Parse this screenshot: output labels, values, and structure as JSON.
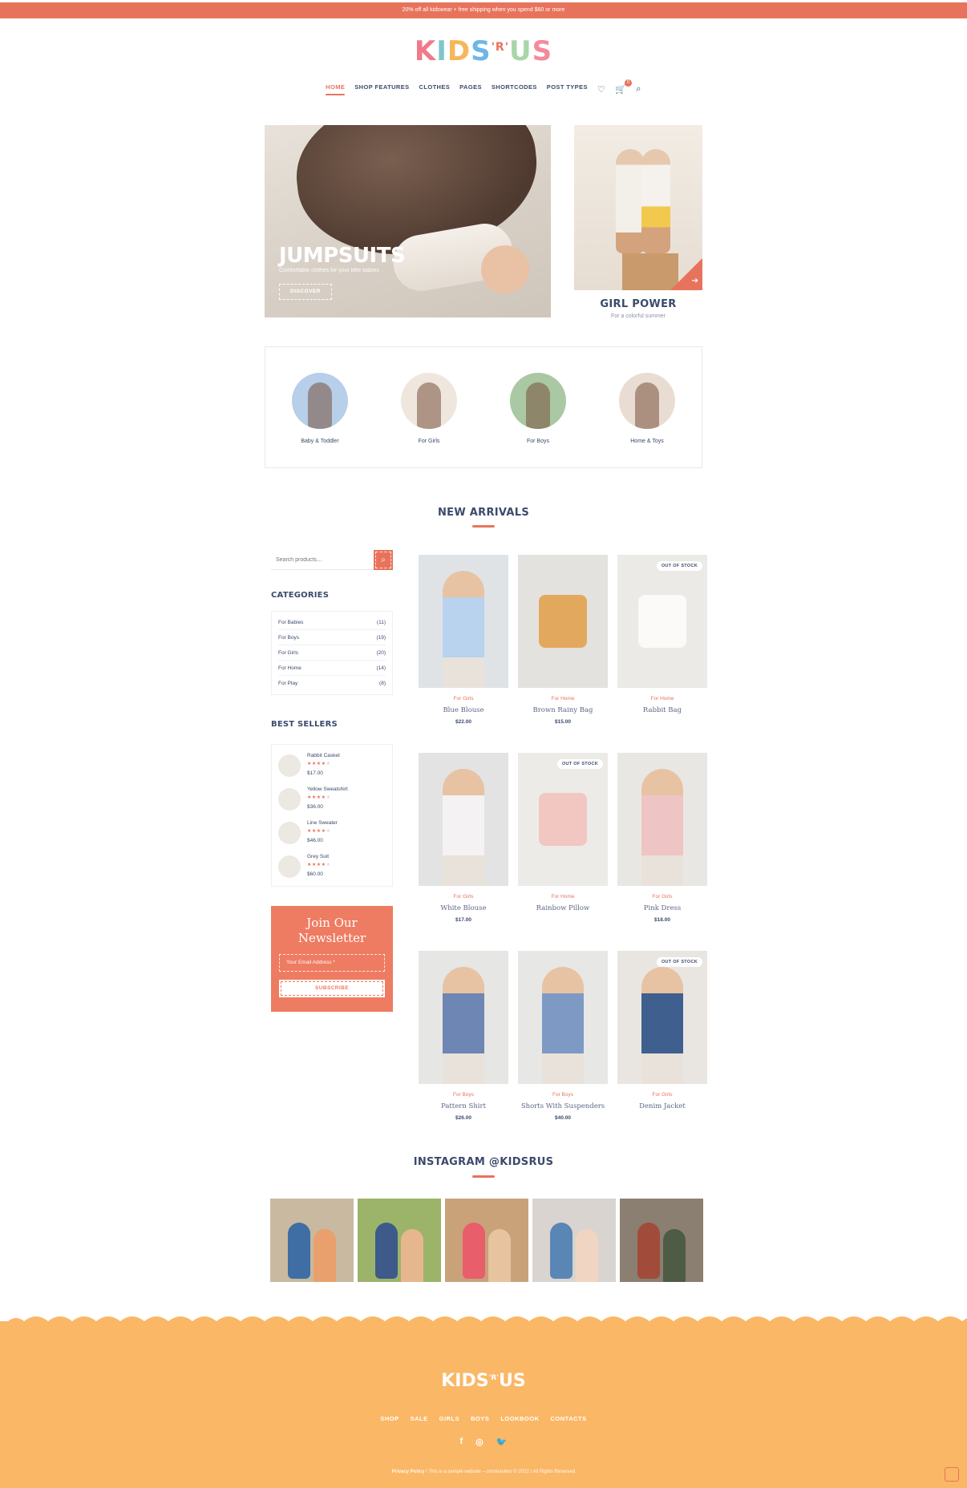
{
  "topbar": {
    "text": "20% off all kidswear + free shipping when you spend $60 or more"
  },
  "logo": {
    "letters": [
      "K",
      "I",
      "D",
      "S",
      "'R'",
      "U",
      "S"
    ],
    "colors": [
      "#f07a8a",
      "#7ec6c9",
      "#f6b65a",
      "#6fb6e8",
      "#e8735c",
      "#a8d6a8",
      "#f48a9a"
    ]
  },
  "nav": {
    "items": [
      "HOME",
      "SHOP FEATURES",
      "CLOTHES",
      "PAGES",
      "SHORTCODES",
      "POST TYPES"
    ],
    "active": "HOME",
    "cart_count": "0",
    "icons": [
      "heart-icon",
      "cart-icon",
      "search-icon"
    ]
  },
  "hero": {
    "title": "JUMPSUITS",
    "subtitle": "Comfortable clothes for your little babies",
    "button": "DISCOVER"
  },
  "promo": {
    "title": "GIRL POWER",
    "subtitle": "For a colorful summer"
  },
  "categories": [
    {
      "label": "Baby & Toddler",
      "bg": "#b7cfe8"
    },
    {
      "label": "For Girls",
      "bg": "#efe7de"
    },
    {
      "label": "For Boys",
      "bg": "#a9c8a3"
    },
    {
      "label": "Home & Toys",
      "bg": "#e9ddd3"
    }
  ],
  "new_arrivals": {
    "title": "NEW ARRIVALS"
  },
  "sidebar": {
    "search_placeholder": "Search products…",
    "categories_title": "CATEGORIES",
    "categories": [
      {
        "name": "For Babies",
        "count": "(11)"
      },
      {
        "name": "For Boys",
        "count": "(19)"
      },
      {
        "name": "For Girls",
        "count": "(20)"
      },
      {
        "name": "For Home",
        "count": "(14)"
      },
      {
        "name": "For Play",
        "count": "(8)"
      }
    ],
    "best_title": "BEST SELLERS",
    "best_sellers": [
      {
        "name": "Rabbit Casket",
        "price": "$17.00",
        "rating": 4
      },
      {
        "name": "Yellow Sweatshirt",
        "price": "$36.00",
        "rating": 4
      },
      {
        "name": "Line Sweater",
        "price": "$46.00",
        "rating": 4
      },
      {
        "name": "Grey Suit",
        "price": "$60.00",
        "rating": 4
      }
    ],
    "newsletter": {
      "title": "Join Our Newsletter",
      "placeholder": "Your Email Address *",
      "button": "SUBSCRIBE"
    }
  },
  "products": [
    {
      "category": "For Girls",
      "name": "Blue Blouse",
      "price": "$22.00",
      "out_of_stock": false,
      "bg": "#dfe3e6",
      "fill": "#b9d2ee",
      "kind": "person"
    },
    {
      "category": "For Home",
      "name": "Brown Rainy Bag",
      "price": "$15.00",
      "out_of_stock": false,
      "bg": "#e4e2df",
      "fill": "#e2a95e",
      "kind": "object"
    },
    {
      "category": "For Home",
      "name": "Rabbit Bag",
      "price": "",
      "out_of_stock": true,
      "bg": "#eceae7",
      "fill": "#fbfaf8",
      "kind": "object"
    },
    {
      "category": "For Girls",
      "name": "White Blouse",
      "price": "$17.00",
      "out_of_stock": false,
      "bg": "#e3e3e3",
      "fill": "#f4f2f2",
      "kind": "person"
    },
    {
      "category": "For Home",
      "name": "Rainbow Pillow",
      "price": "",
      "out_of_stock": true,
      "bg": "#ecebe8",
      "fill": "#f2c6c1",
      "kind": "object"
    },
    {
      "category": "For Girls",
      "name": "Pink Dress",
      "price": "$18.00",
      "out_of_stock": false,
      "bg": "#e9e7e4",
      "fill": "#efc4c4",
      "kind": "person"
    },
    {
      "category": "For Boys",
      "name": "Pattern Shirt",
      "price": "$26.00",
      "out_of_stock": false,
      "bg": "#e6e6e4",
      "fill": "#6d86b3",
      "kind": "person"
    },
    {
      "category": "For Boys",
      "name": "Shorts With Suspenders",
      "price": "$40.00",
      "out_of_stock": false,
      "bg": "#e7e7e5",
      "fill": "#7e9ac4",
      "kind": "person"
    },
    {
      "category": "For Girls",
      "name": "Denim Jacket",
      "price": "",
      "out_of_stock": true,
      "bg": "#e9e6e2",
      "fill": "#3f5f8f",
      "kind": "person"
    }
  ],
  "oos_label": "OUT OF STOCK",
  "instagram": {
    "title": "INSTAGRAM @KIDSRUS",
    "photos": [
      {
        "bg": "#c9b9a0",
        "a": "#3f6ea5",
        "b": "#e9a06c"
      },
      {
        "bg": "#9cb46a",
        "a": "#3d5a8a",
        "b": "#e6b78e"
      },
      {
        "bg": "#c9a27a",
        "a": "#e85e6a",
        "b": "#e8c3a0"
      },
      {
        "bg": "#d9d4cf",
        "a": "#5a86b5",
        "b": "#f0d6c2"
      },
      {
        "bg": "#8a7f70",
        "a": "#a14c3a",
        "b": "#4e5b45"
      }
    ]
  },
  "footer": {
    "logo_main": "KIDS",
    "logo_small": "'R'",
    "logo_end": "US",
    "nav": [
      "SHOP",
      "SALE",
      "GIRLS",
      "BOYS",
      "LOOKBOOK",
      "CONTACTS"
    ],
    "social": [
      "f",
      "◎",
      "🐦"
    ],
    "privacy": "Privacy Policy",
    "copyright": " / This is a sample website – cmsmasters © 2022 / All Rights Reserved"
  }
}
